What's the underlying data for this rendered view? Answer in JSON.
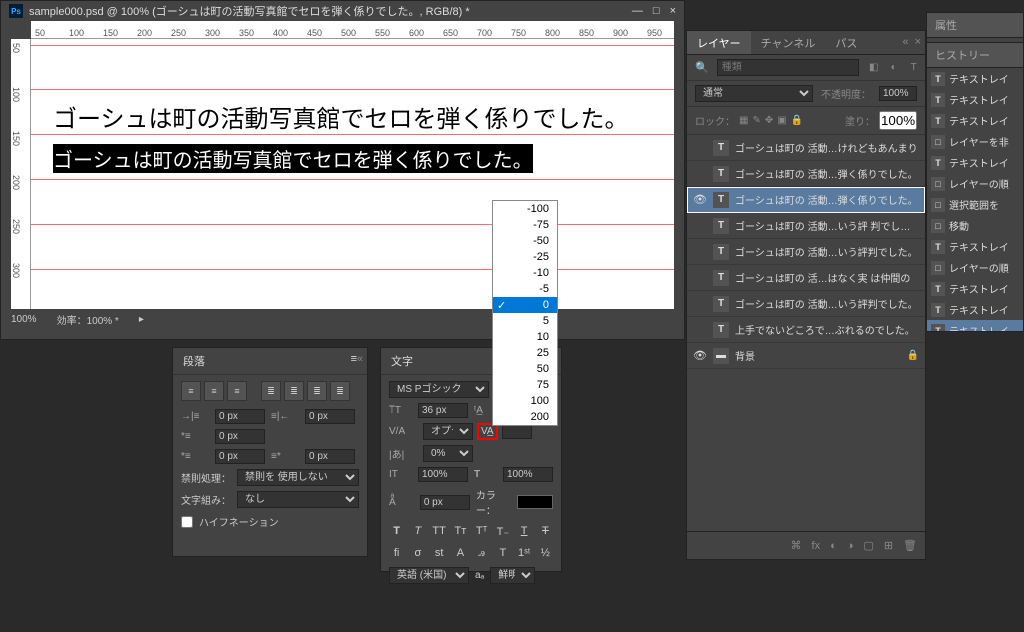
{
  "window": {
    "title": "sample000.psd @ 100% (ゴーシュは町の活動写真館でセロを弾く係りでした。, RGB/8) *",
    "ruler_h": [
      50,
      100,
      150,
      200,
      250,
      300,
      350,
      400,
      450,
      500,
      550,
      600,
      650,
      700,
      750,
      800,
      850,
      900,
      950
    ],
    "ruler_v": [
      50,
      100,
      150,
      200,
      250,
      300
    ],
    "status_zoom": "100%",
    "status_eff": "効率：100% *"
  },
  "canvas": {
    "text1": "ゴーシュは町の活動写真館でセロを弾く係りでした。",
    "text2": "ゴーシュは町の活動写真館でセロを弾く係りでした。"
  },
  "tracking_dropdown": [
    "-100",
    "-75",
    "-50",
    "-25",
    "-10",
    "-5",
    "0",
    "5",
    "10",
    "25",
    "50",
    "75",
    "100",
    "200"
  ],
  "tracking_selected": "0",
  "layers_panel": {
    "tabs": [
      "レイヤー",
      "チャンネル",
      "パス"
    ],
    "search_placeholder": "種類",
    "blend_mode": "通常",
    "opacity_label": "不透明度：",
    "opacity_value": "100%",
    "lock_label": "ロック：",
    "fill_label": "塗り：",
    "fill_value": "100%",
    "items": [
      {
        "vis": "",
        "type": "T",
        "name": "ゴーシュは町の 活動…けれどもあんまり"
      },
      {
        "vis": "",
        "type": "T",
        "name": "ゴーシュは町の 活動…弾く係りでした。"
      },
      {
        "vis": "👁",
        "type": "T",
        "name": "ゴーシュは町の 活動…弾く係りでした。",
        "selected": true
      },
      {
        "vis": "",
        "type": "T",
        "name": "ゴーシュは町の 活動…いう評 判でした。"
      },
      {
        "vis": "",
        "type": "T",
        "name": "ゴーシュは町の 活動…いう評判でした。"
      },
      {
        "vis": "",
        "type": "T",
        "name": "ゴーシュは町の 活…はなく実 は仲間の"
      },
      {
        "vis": "",
        "type": "T",
        "name": "ゴーシュは町の 活動…いう評判でした。"
      },
      {
        "vis": "",
        "type": "T",
        "name": "上手でないどころで…ぶれるのでした。"
      },
      {
        "vis": "👁",
        "type": "BG",
        "name": "背景",
        "lock": true
      }
    ]
  },
  "properties_label": "属性",
  "history_panel": {
    "label": "ヒストリー",
    "items": [
      {
        "type": "T",
        "name": "テキストレイ"
      },
      {
        "type": "T",
        "name": "テキストレイ"
      },
      {
        "type": "T",
        "name": "テキストレイ"
      },
      {
        "type": "□",
        "name": "レイヤーを非"
      },
      {
        "type": "T",
        "name": "テキストレイ"
      },
      {
        "type": "□",
        "name": "レイヤーの順"
      },
      {
        "type": "□",
        "name": "選択範囲を"
      },
      {
        "type": "□",
        "name": "移動"
      },
      {
        "type": "T",
        "name": "テキストレイ"
      },
      {
        "type": "□",
        "name": "レイヤーの順"
      },
      {
        "type": "T",
        "name": "テキストレイ"
      },
      {
        "type": "T",
        "name": "テキストレイ"
      },
      {
        "type": "T",
        "name": "テキストレイ",
        "selected": true
      }
    ]
  },
  "paragraph": {
    "title": "段落",
    "indent_left": "0 px",
    "indent_right": "0 px",
    "indent_first": "0 px",
    "space_before": "0 px",
    "space_after": "0 px",
    "prohibition_label": "禁則処理：",
    "prohibition_value": "禁則を 使用しない",
    "composing_label": "文字組み：",
    "composing_value": "なし",
    "hyphenation": "ハイフネーション"
  },
  "character": {
    "title": "文字",
    "font": "MS Pゴシック",
    "size": "36 px",
    "kerning": "オプティカル",
    "tracking_value": "",
    "baseline": "0%",
    "scale_v": "100%",
    "scale_h": "100%",
    "baseline_shift": "0 px",
    "color_label": "カラー：",
    "language": "英語 (米国)",
    "aa_label": "aₐ",
    "aa_value": "鮮明"
  }
}
